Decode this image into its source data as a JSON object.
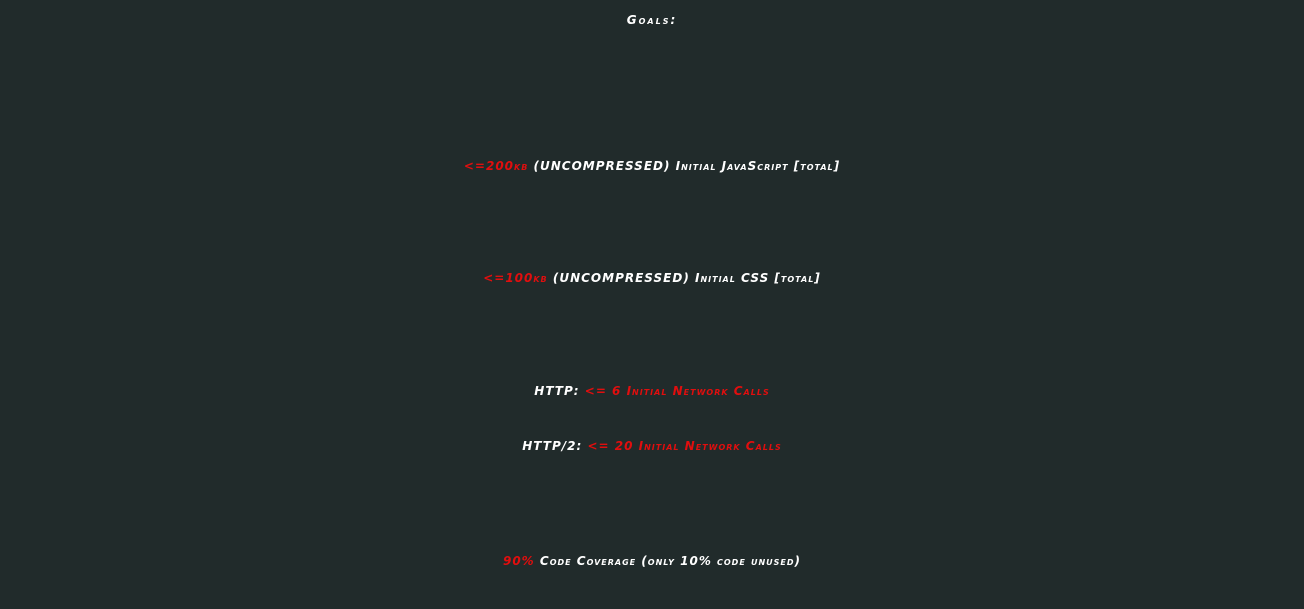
{
  "title": "Goals:",
  "goals": [
    {
      "highlight": "<=200kb",
      "text": " (UNCOMPRESSED) Initial JavaScript [total]"
    },
    {
      "highlight": "<=100kb",
      "text": " (UNCOMPRESSED) Initial CSS [total]"
    },
    {
      "label": "HTTP: ",
      "highlight": "<= 6 Initial Network Calls"
    },
    {
      "label": "HTTP/2: ",
      "highlight": "<= 20 Initial Network Calls"
    },
    {
      "highlight": "90%",
      "text": " Code Coverage (only 10% code unused)"
    }
  ],
  "colors": {
    "background": "#212b2b",
    "text": "#ffffff",
    "highlight": "#e10e0e"
  }
}
